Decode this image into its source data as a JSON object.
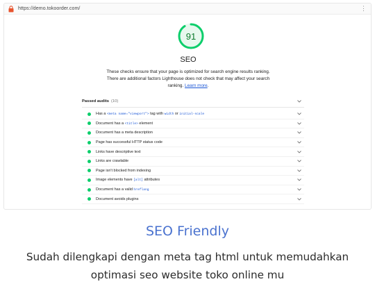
{
  "browser": {
    "url": "https://demo.tokoorder.com/",
    "menu_glyph": "⋮"
  },
  "lighthouse": {
    "score": "91",
    "score_fraction": 0.91,
    "category": "SEO",
    "description": "These checks ensure that your page is optimized for search engine results ranking. There are additional factors Lighthouse does not check that may affect your search ranking.",
    "learn_more": "Learn more",
    "colors": {
      "pass": "#0cce6b",
      "score_text": "#0c7a2c",
      "link": "#1a56d6"
    },
    "group": {
      "title": "Passed audits",
      "count": "(10)"
    },
    "audits": [
      {
        "pre": "Has a ",
        "code1": "<meta name=\"viewport\">",
        "mid": " tag with ",
        "code2": "width",
        "mid2": " or ",
        "code3": "initial-scale",
        "post": ""
      },
      {
        "pre": "Document has a ",
        "code1": "<title>",
        "mid": " element",
        "code2": "",
        "mid2": "",
        "code3": "",
        "post": ""
      },
      {
        "pre": "Document has a meta description",
        "code1": "",
        "mid": "",
        "code2": "",
        "mid2": "",
        "code3": "",
        "post": ""
      },
      {
        "pre": "Page has successful HTTP status code",
        "code1": "",
        "mid": "",
        "code2": "",
        "mid2": "",
        "code3": "",
        "post": ""
      },
      {
        "pre": "Links have descriptive text",
        "code1": "",
        "mid": "",
        "code2": "",
        "mid2": "",
        "code3": "",
        "post": ""
      },
      {
        "pre": "Links are crawlable",
        "code1": "",
        "mid": "",
        "code2": "",
        "mid2": "",
        "code3": "",
        "post": ""
      },
      {
        "pre": "Page isn't blocked from indexing",
        "code1": "",
        "mid": "",
        "code2": "",
        "mid2": "",
        "code3": "",
        "post": ""
      },
      {
        "pre": "Image elements have ",
        "code1": "[alt]",
        "mid": " attributes",
        "code2": "",
        "mid2": "",
        "code3": "",
        "post": ""
      },
      {
        "pre": "Document has a valid ",
        "code1": "hreflang",
        "mid": "",
        "code2": "",
        "mid2": "",
        "code3": "",
        "post": ""
      },
      {
        "pre": "Document avoids plugins",
        "code1": "",
        "mid": "",
        "code2": "",
        "mid2": "",
        "code3": "",
        "post": ""
      }
    ]
  },
  "feature": {
    "title": "SEO Friendly",
    "description": "Sudah dilengkapi dengan meta tag html untuk memudahkan optimasi seo website toko online mu",
    "title_color": "#4a72cf"
  }
}
